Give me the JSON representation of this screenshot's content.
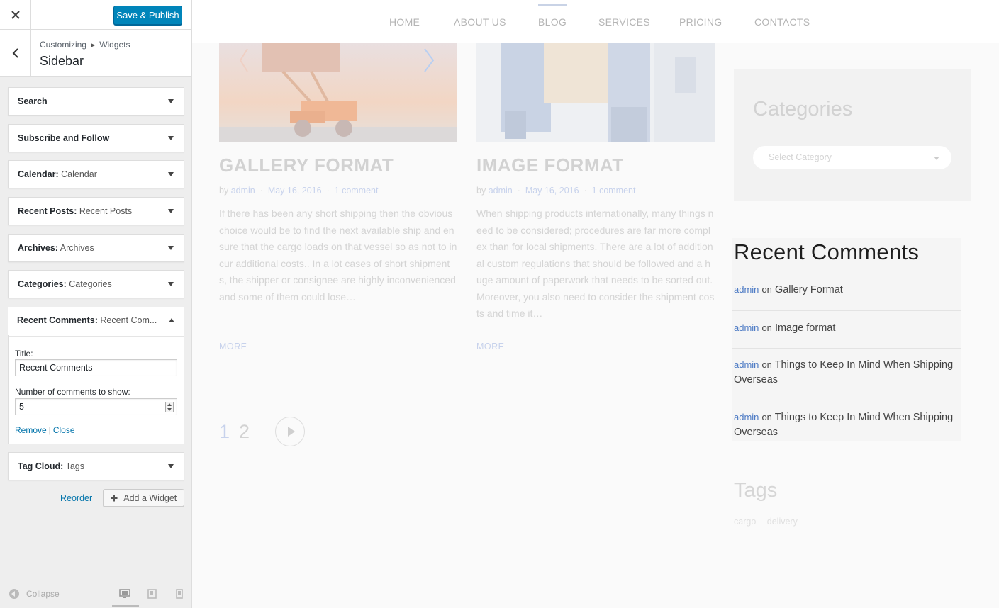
{
  "customizer": {
    "close_icon": "close-icon",
    "save_label": "Save & Publish",
    "breadcrumb": {
      "first": "Customizing",
      "second": "Widgets"
    },
    "title": "Sidebar",
    "widgets": [
      {
        "type": "Search",
        "title": ""
      },
      {
        "type": "Subscribe and Follow",
        "title": ""
      },
      {
        "type": "Calendar:",
        "title": "Calendar"
      },
      {
        "type": "Recent Posts:",
        "title": "Recent Posts"
      },
      {
        "type": "Archives:",
        "title": "Archives"
      },
      {
        "type": "Categories:",
        "title": "Categories"
      }
    ],
    "expanded_widget": {
      "type": "Recent Comments:",
      "title": "Recent Com...",
      "title_label": "Title:",
      "title_value": "Recent Comments",
      "number_label": "Number of comments to show:",
      "number_value": "5",
      "remove_label": "Remove",
      "separator": "|",
      "close_label": "Close"
    },
    "tag_cloud": {
      "type": "Tag Cloud:",
      "title": "Tags"
    },
    "reorder_label": "Reorder",
    "add_widget_label": "Add a Widget",
    "collapse_label": "Collapse"
  },
  "preview": {
    "nav": [
      "HOME",
      "ABOUT US",
      "BLOG",
      "SERVICES",
      "PRICING",
      "CONTACTS"
    ],
    "nav_active": "BLOG",
    "posts": [
      {
        "title": "GALLERY FORMAT",
        "by": "by",
        "author": "admin",
        "date": "May 16, 2016",
        "comments": "1 comment",
        "excerpt": "If there has been any short shipping then the obvious choice would be to find the next available ship and ensure that the cargo loads on that vessel so as not to incur additional costs.. In a lot cases of short shipments, the shipper or consignee are highly inconvenienced and some of them could lose…",
        "more": "MORE"
      },
      {
        "title": "IMAGE FORMAT",
        "by": "by",
        "author": "admin",
        "date": "May 16, 2016",
        "comments": "1 comment",
        "excerpt": "When shipping products internationally, many things need to be considered; procedures are far more complex than for local shipments. There are a lot of additional custom regulations that should be followed and a huge amount of paperwork that needs to be sorted out. Moreover, you also need to consider the shipment costs and time it…",
        "more": "MORE"
      }
    ],
    "pagination": {
      "page1": "1",
      "page2": "2"
    },
    "categories": {
      "title": "Categories",
      "select_placeholder": "Select Category"
    },
    "recent_comments": {
      "title": "Recent Comments",
      "items": [
        {
          "author": "admin",
          "on": "on",
          "post": "Gallery Format"
        },
        {
          "author": "admin",
          "on": "on",
          "post": "Image format"
        },
        {
          "author": "admin",
          "on": "on",
          "post": "Things to Keep In Mind When Shipping Overseas"
        },
        {
          "author": "admin",
          "on": "on",
          "post": "Things to Keep In Mind When Shipping Overseas"
        }
      ]
    },
    "tags": {
      "title": "Tags",
      "items": [
        "cargo",
        "delivery"
      ]
    }
  },
  "colors": {
    "primary_button": "#0085ba",
    "link": "#0073aa",
    "comment_author": "#4c7ac4"
  }
}
